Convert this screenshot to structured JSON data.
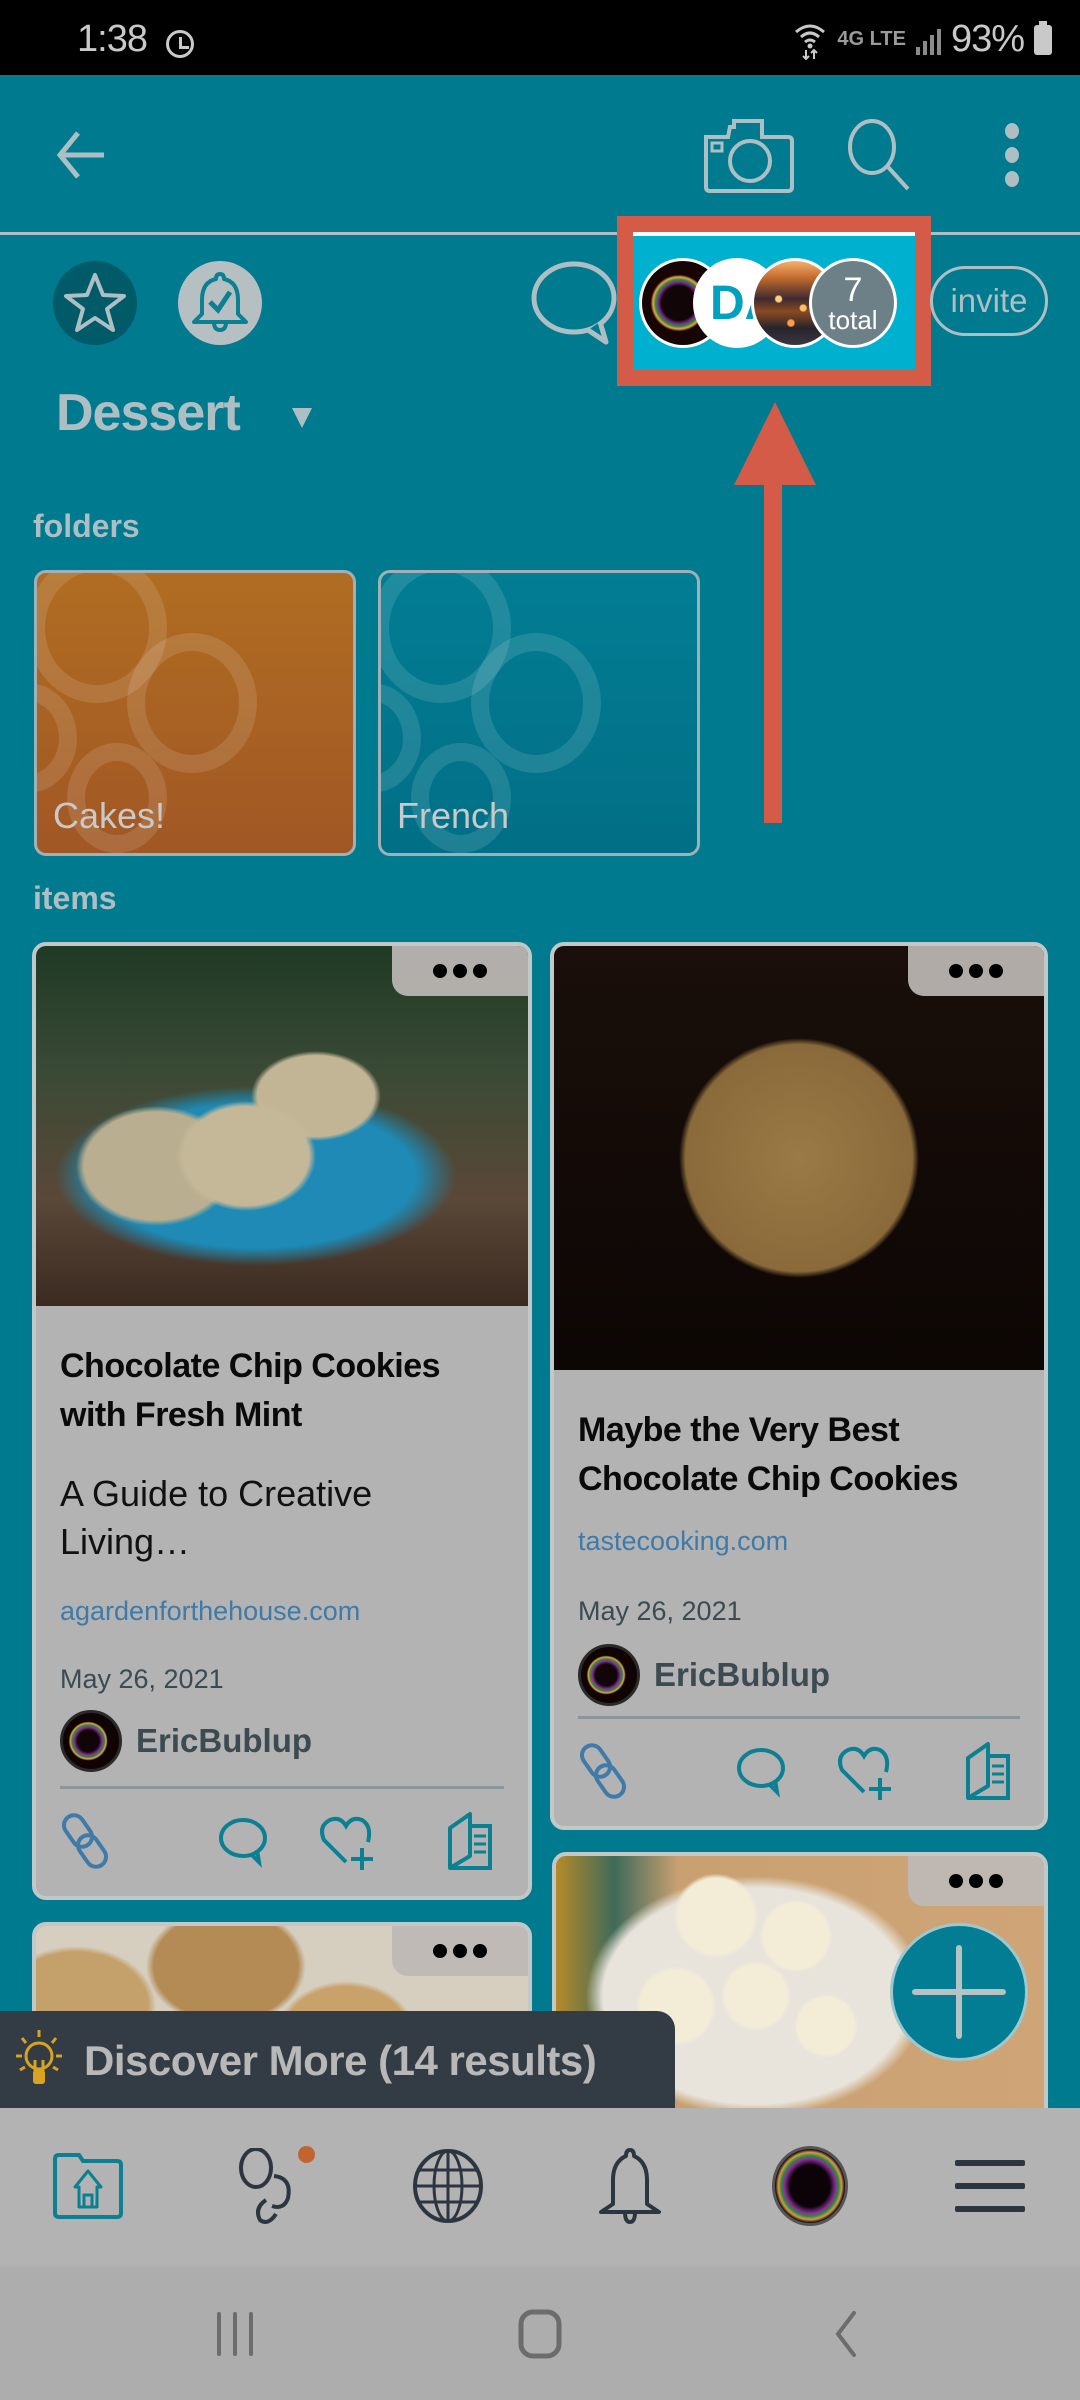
{
  "status_bar": {
    "time": "1:38",
    "network": "4G LTE",
    "battery": "93%"
  },
  "app_bar": {
    "icons": [
      "back-arrow-icon",
      "camera-icon",
      "search-icon",
      "more-vert-icon"
    ]
  },
  "header": {
    "title": "Dessert",
    "invite_label": "invite",
    "members": {
      "initials_avatar": "DA",
      "total_count": "7",
      "total_label": "total"
    }
  },
  "colors": {
    "background": "#007a8f",
    "highlight": "#d35b47",
    "members_bg": "#00b0cf",
    "link": "#3f7aa8",
    "discover_bg": "#333b45",
    "badge": "#c0652f"
  },
  "folders": {
    "label": "folders",
    "items": [
      {
        "name": "Cakes!",
        "color": "#a85e23"
      },
      {
        "name": "French",
        "color": "#017890"
      }
    ]
  },
  "items": {
    "label": "items",
    "cards": [
      {
        "title": "Chocolate Chip Cookies with Fresh Mint",
        "description": "A Guide to Creative Living…",
        "source": "agardenforthehouse.com",
        "date": "May 26, 2021",
        "author": "EricBublup"
      },
      {
        "title": "Maybe the Very Best Chocolate Chip Cookies",
        "source": "tastecooking.com",
        "date": "May 26, 2021",
        "author": "EricBublup"
      },
      {
        "image": "cookies-on-parchment"
      },
      {
        "image": "cupcakes-on-plate"
      }
    ],
    "card_actions": [
      "link-icon",
      "comment-icon",
      "heart-plus-icon",
      "open-book-icon"
    ]
  },
  "discover": {
    "label": "Discover More (14 results)"
  },
  "bottom_nav": {
    "items": [
      "home-folder",
      "groups",
      "explore",
      "notifications",
      "profile",
      "menu"
    ],
    "active": "home-folder"
  },
  "system_nav": [
    "recents",
    "home",
    "back"
  ]
}
